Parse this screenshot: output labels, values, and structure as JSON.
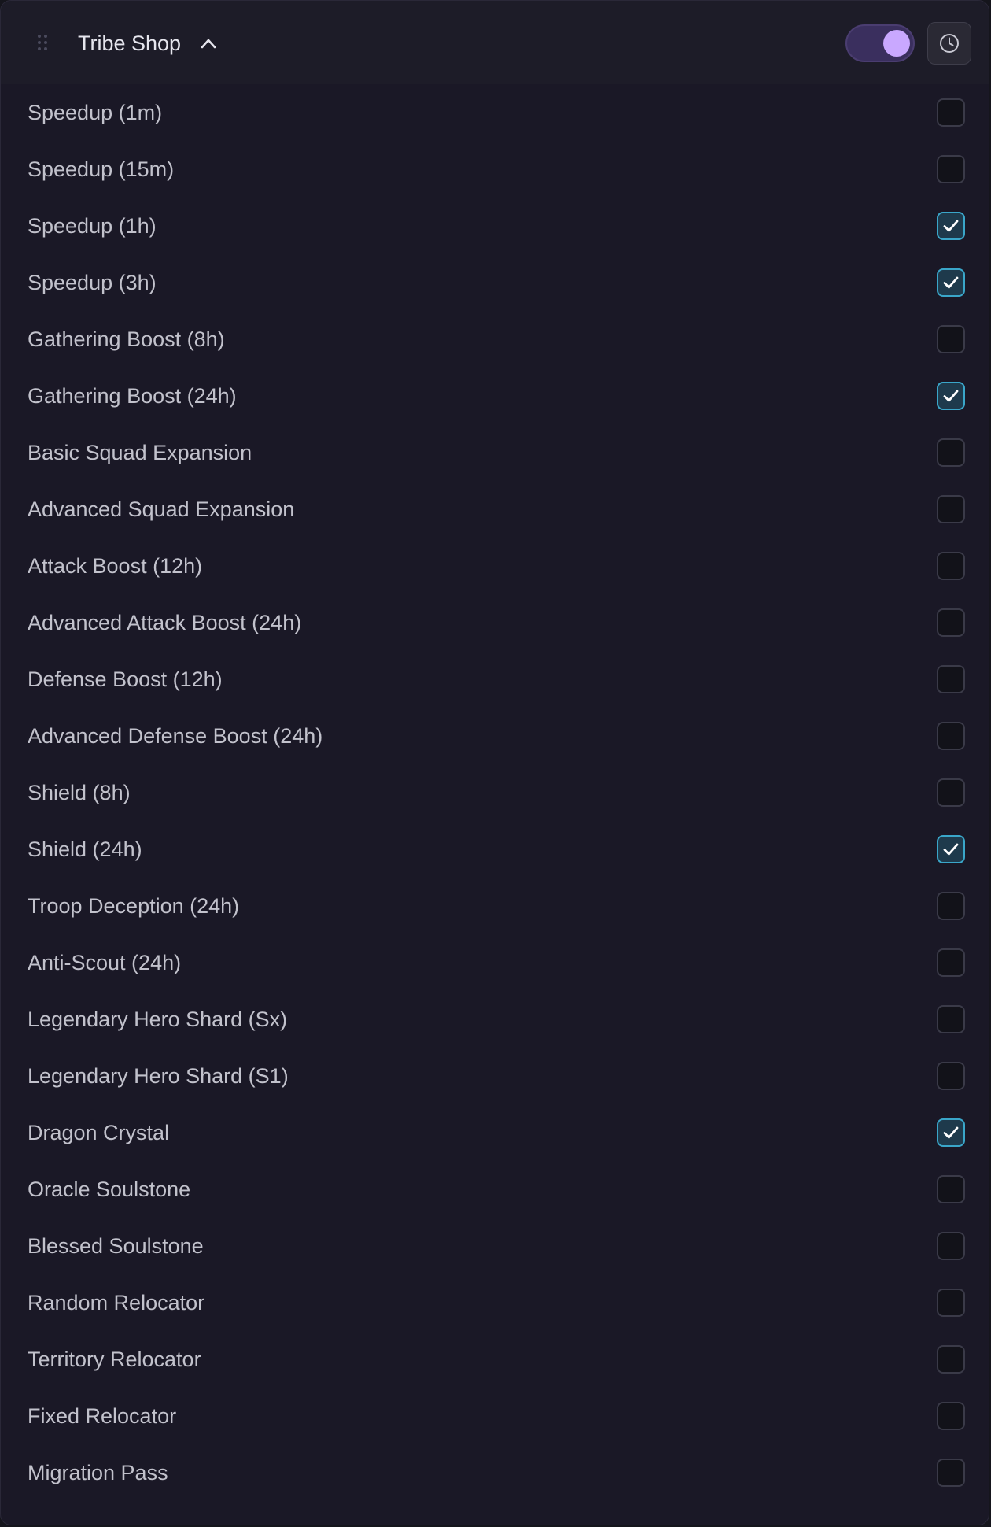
{
  "header": {
    "title": "Tribe Shop",
    "enabled": true,
    "drag_icon": "grip-dots-icon",
    "collapse_icon": "chevron-up-icon",
    "history_icon": "clock-icon"
  },
  "colors": {
    "accent": "#c9a8ff",
    "check": "#3aa6c9"
  },
  "items": [
    {
      "label": "Speedup (1m)",
      "checked": false
    },
    {
      "label": "Speedup (15m)",
      "checked": false
    },
    {
      "label": "Speedup (1h)",
      "checked": true
    },
    {
      "label": "Speedup (3h)",
      "checked": true
    },
    {
      "label": "Gathering Boost (8h)",
      "checked": false
    },
    {
      "label": "Gathering Boost (24h)",
      "checked": true
    },
    {
      "label": "Basic Squad Expansion",
      "checked": false
    },
    {
      "label": "Advanced Squad Expansion",
      "checked": false
    },
    {
      "label": "Attack Boost (12h)",
      "checked": false
    },
    {
      "label": "Advanced Attack Boost (24h)",
      "checked": false
    },
    {
      "label": "Defense Boost (12h)",
      "checked": false
    },
    {
      "label": "Advanced Defense Boost (24h)",
      "checked": false
    },
    {
      "label": "Shield (8h)",
      "checked": false
    },
    {
      "label": "Shield (24h)",
      "checked": true
    },
    {
      "label": "Troop Deception (24h)",
      "checked": false
    },
    {
      "label": "Anti-Scout (24h)",
      "checked": false
    },
    {
      "label": "Legendary Hero Shard (Sx)",
      "checked": false
    },
    {
      "label": "Legendary Hero Shard (S1)",
      "checked": false
    },
    {
      "label": "Dragon Crystal",
      "checked": true
    },
    {
      "label": "Oracle Soulstone",
      "checked": false
    },
    {
      "label": "Blessed Soulstone",
      "checked": false
    },
    {
      "label": "Random Relocator",
      "checked": false
    },
    {
      "label": "Territory Relocator",
      "checked": false
    },
    {
      "label": "Fixed Relocator",
      "checked": false
    },
    {
      "label": "Migration Pass",
      "checked": false
    }
  ]
}
